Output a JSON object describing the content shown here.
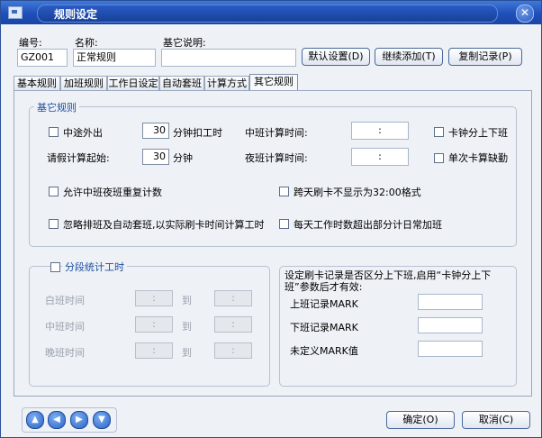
{
  "window": {
    "title": "规则设定",
    "close_glyph": "✕"
  },
  "header": {
    "code_label": "编号:",
    "code_value": "GZ001",
    "name_label": "名称:",
    "name_value": "正常规则",
    "desc_label": "基它说明:",
    "desc_value": "",
    "default_btn": "默认设置(D)",
    "continue_add_btn": "继续添加(T)",
    "copy_record_btn": "复制记录(P)"
  },
  "tabs": [
    {
      "label": "基本规则"
    },
    {
      "label": "加班规则"
    },
    {
      "label": "工作日设定"
    },
    {
      "label": "自动套班"
    },
    {
      "label": "计算方式"
    },
    {
      "label": "其它规则"
    }
  ],
  "other_rules": {
    "group_title": "基它规则",
    "midway_out_label": "中途外出",
    "midway_out_checked": false,
    "midway_minutes": "30",
    "midway_minutes_suffix": "分钟扣工时",
    "leave_start_label": "请假计算起始:",
    "leave_minutes": "30",
    "leave_minutes_suffix": "分钟",
    "mid_shift_time_label": "中班计算时间:",
    "mid_shift_time_value": ":",
    "night_shift_time_label": "夜班计算时间:",
    "night_shift_time_value": ":",
    "clock_split_label": "卡钟分上下班",
    "single_card_absent_label": "单次卡算缺勤",
    "allow_repeat_label": "允许中班夜班重复计数",
    "cross_day_label": "跨天刷卡不显示为32:00格式",
    "ignore_schedule_label": "忽略排班及自动套班,以实际刷卡时间计算工时",
    "daily_overtime_label": "每天工作时数超出部分计日常加班"
  },
  "segment": {
    "title": "分段统计工时",
    "checked": false,
    "day_label": "白班时间",
    "mid_label": "中班时间",
    "night_label": "晚班时间",
    "to_label": "到",
    "time_placeholder": ":"
  },
  "mark": {
    "note": "设定刷卡记录是否区分上下班,启用“卡钟分上下班”参数后才有效:",
    "on_duty_label": "上班记录MARK",
    "off_duty_label": "下班记录MARK",
    "undefined_label": "未定义MARK值",
    "on_duty_value": "",
    "off_duty_value": "",
    "undefined_value": ""
  },
  "nav": {
    "first_icon": "up-arrow-icon",
    "prev_icon": "left-arrow-icon",
    "next_icon": "right-arrow-icon",
    "last_icon": "down-arrow-icon",
    "first_glyph": "▲",
    "prev_glyph": "◀",
    "next_glyph": "▶",
    "last_glyph": "▼"
  },
  "footer": {
    "ok_btn": "确定(O)",
    "cancel_btn": "取消(C)"
  },
  "colors": {
    "title_bar": "#1f4fb8",
    "group_title": "#1d4ea0",
    "background": "#eef1f6"
  }
}
